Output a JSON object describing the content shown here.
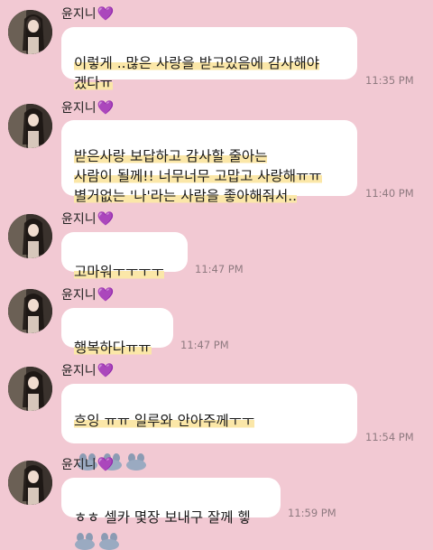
{
  "sender_name": "윤지니",
  "heart_icon": "purple-heart-icon",
  "colors": {
    "background": "#f2c9d3",
    "bubble": "#ffffff",
    "heart": "#9b3fd8",
    "timestamp": "#8f7a80"
  },
  "messages": [
    {
      "sender": "윤지니",
      "text": "이렇게 ..많은 사랑을 받고있음에 감사해야\n겠다ㅠ",
      "time": "11:35 PM"
    },
    {
      "sender": "윤지니",
      "text": "받은사랑 보답하고 감사할 줄아는\n사람이 될께!! 너무너무 고맙고 사랑해ㅠㅠ\n별거없는 '나'라는 사람을 좋아해줘서..",
      "time": "11:40 PM"
    },
    {
      "sender": "윤지니",
      "text": "고마워ㅜㅜㅜㅜ",
      "time": "11:47 PM"
    },
    {
      "sender": "윤지니",
      "text": "행복하다ㅠㅠ",
      "time": "11:47 PM"
    },
    {
      "sender": "윤지니",
      "text": "흐잉 ㅠㅠ 일루와 안아주께ㅜㅜ",
      "time": "11:54 PM",
      "emoji": "hugging-bunny-emoticon"
    },
    {
      "sender": "윤지니",
      "text": "ㅎㅎ 셀카 몇장 보내구 잘께 헿",
      "time": "11:59 PM"
    }
  ]
}
